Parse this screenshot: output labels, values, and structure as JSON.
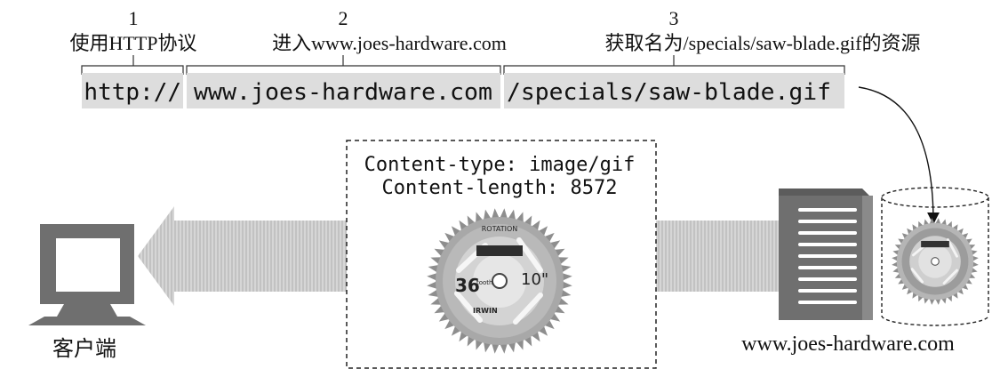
{
  "url": {
    "scheme": "http://",
    "host": "www.joes-hardware.com",
    "path": "/specials/saw-blade.gif"
  },
  "callouts": [
    {
      "number": "1",
      "label": "使用HTTP协议"
    },
    {
      "number": "2",
      "label": "进入www.joes-hardware.com"
    },
    {
      "number": "3",
      "label": "获取名为/specials/saw-blade.gif的资源"
    }
  ],
  "response": {
    "content_type": "Content-type: image/gif",
    "content_length": "Content-length: 8572"
  },
  "client": {
    "label": "客户端"
  },
  "server": {
    "label": "www.joes-hardware.com"
  },
  "blade_text": {
    "rotation": "ROTATION",
    "teeth_count": "36",
    "teeth_word": "tooth",
    "diameter": "10\"",
    "brand": "IRWIN"
  }
}
